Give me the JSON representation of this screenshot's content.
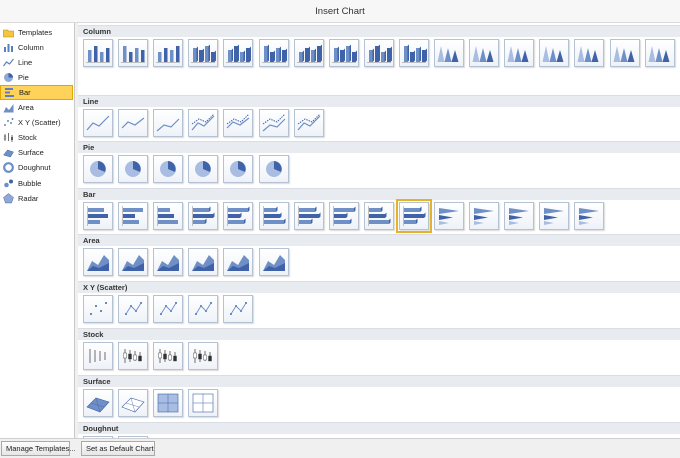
{
  "window": {
    "title": "Insert Chart"
  },
  "sidebar": {
    "items": [
      {
        "label": "Templates",
        "icon": "folder-icon"
      },
      {
        "label": "Column",
        "icon": "column-chart-icon"
      },
      {
        "label": "Line",
        "icon": "line-chart-icon"
      },
      {
        "label": "Pie",
        "icon": "pie-chart-icon"
      },
      {
        "label": "Bar",
        "icon": "bar-chart-icon",
        "selected": true
      },
      {
        "label": "Area",
        "icon": "area-chart-icon"
      },
      {
        "label": "X Y (Scatter)",
        "icon": "scatter-chart-icon"
      },
      {
        "label": "Stock",
        "icon": "stock-chart-icon"
      },
      {
        "label": "Surface",
        "icon": "surface-chart-icon"
      },
      {
        "label": "Doughnut",
        "icon": "doughnut-chart-icon"
      },
      {
        "label": "Bubble",
        "icon": "bubble-chart-icon"
      },
      {
        "label": "Radar",
        "icon": "radar-chart-icon"
      }
    ]
  },
  "gallery": {
    "categories": [
      {
        "label": "Column",
        "count": 17,
        "kind": "column"
      },
      {
        "label": "Line",
        "count": 7,
        "kind": "line"
      },
      {
        "label": "Pie",
        "count": 6,
        "kind": "pie"
      },
      {
        "label": "Bar",
        "count": 15,
        "kind": "bar",
        "selected_index": 9
      },
      {
        "label": "Area",
        "count": 6,
        "kind": "area"
      },
      {
        "label": "X Y (Scatter)",
        "count": 5,
        "kind": "scatter"
      },
      {
        "label": "Stock",
        "count": 4,
        "kind": "stock"
      },
      {
        "label": "Surface",
        "count": 4,
        "kind": "surface"
      },
      {
        "label": "Doughnut",
        "count": 2,
        "kind": "doughnut"
      }
    ]
  },
  "footer": {
    "manage_templates": "Manage Templates...",
    "set_default": "Set as Default Chart"
  },
  "colors": {
    "selected_fill": "#ffd35a",
    "selected_border": "#e0a800",
    "chart_blue": "#6f8fc7"
  }
}
